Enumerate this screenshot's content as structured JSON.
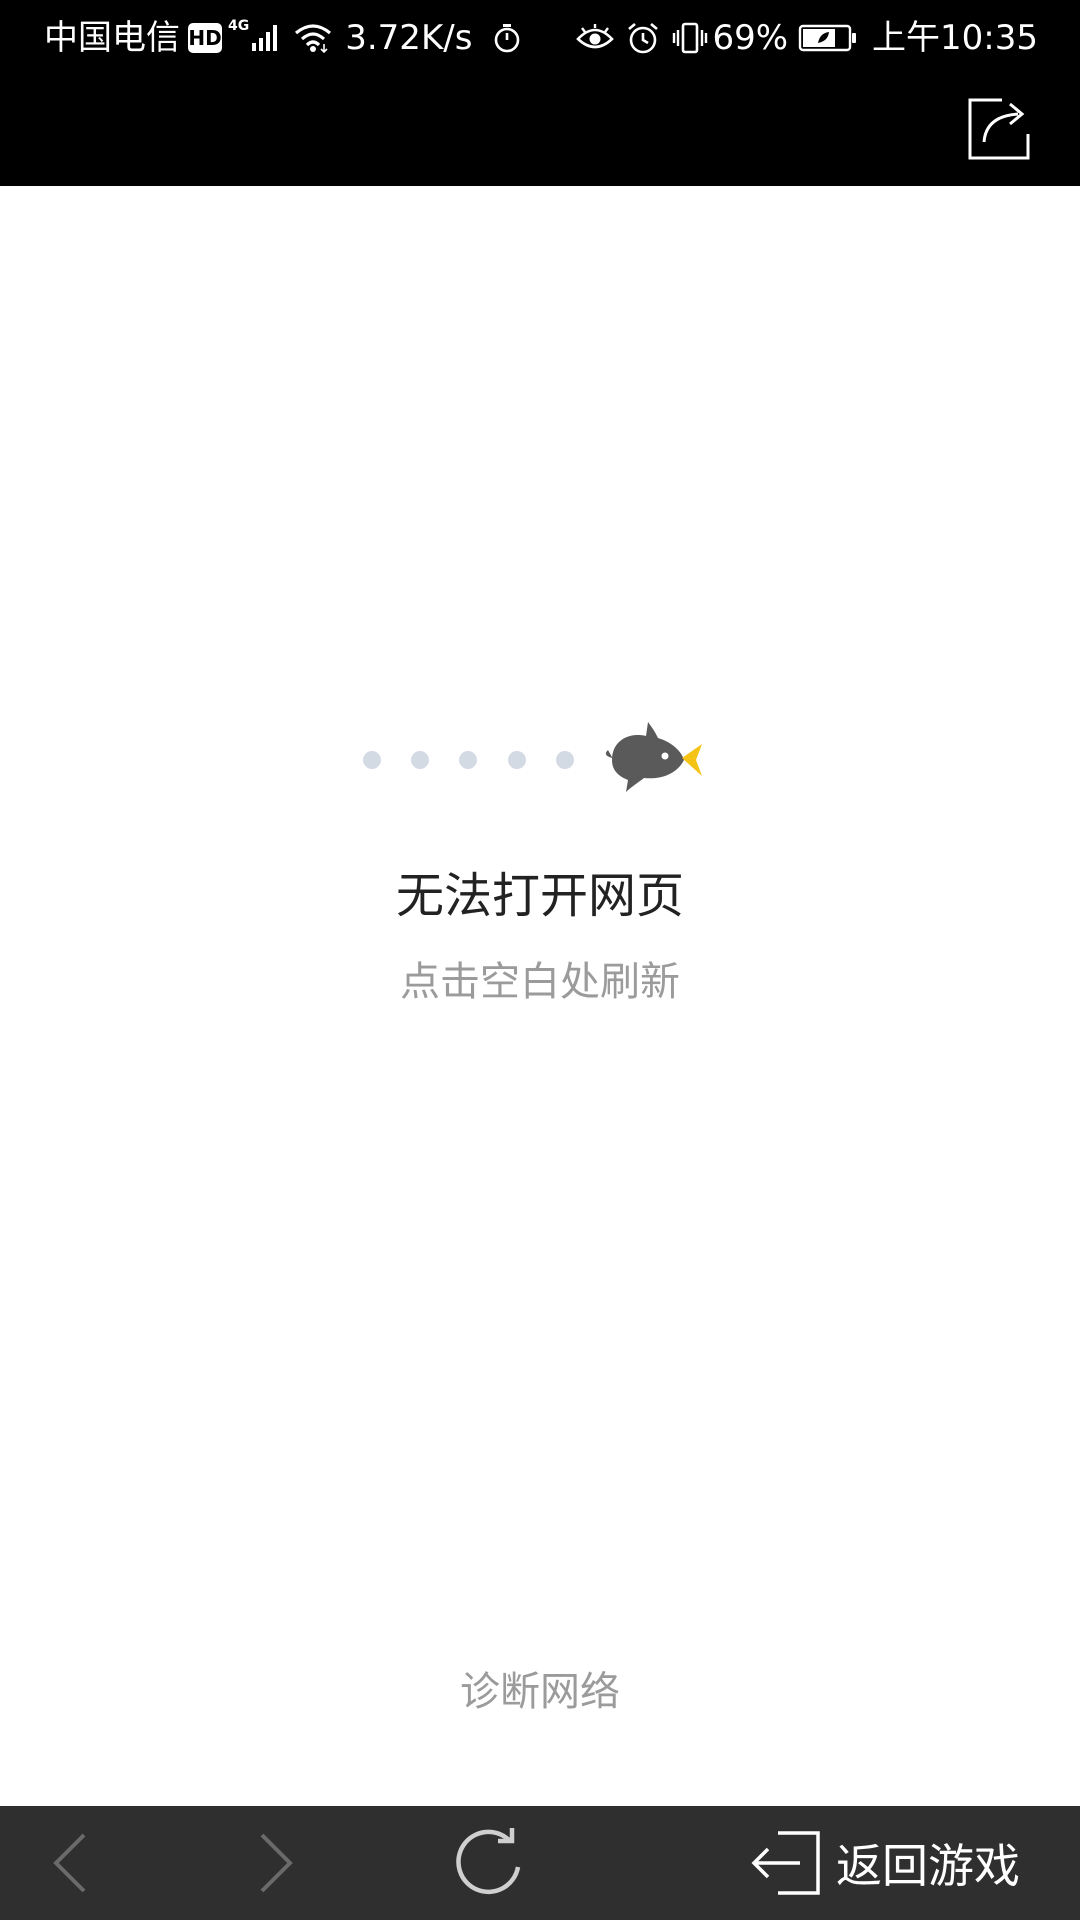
{
  "status_bar": {
    "carrier": "中国电信",
    "hd_badge": "HD",
    "network_type": "4G",
    "net_speed": "3.72K/s",
    "battery_percent": "69%",
    "time": "上午10:35",
    "icons": [
      "hd-icon",
      "signal-icon",
      "wifi-icon",
      "stopwatch-icon",
      "eye-icon",
      "alarm-icon",
      "vibrate-icon",
      "battery-icon"
    ]
  },
  "header": {
    "share_icon": "share-icon"
  },
  "error_page": {
    "title": "无法打开网页",
    "hint": "点击空白处刷新",
    "diagnose_link": "诊断网络",
    "loader_dots": 5,
    "mascot_icon": "bird-icon"
  },
  "toolbar": {
    "back_icon": "chevron-left-icon",
    "forward_icon": "chevron-right-icon",
    "reload_icon": "reload-icon",
    "return_icon": "exit-icon",
    "return_label": "返回游戏"
  },
  "colors": {
    "status_bar_bg": "#000000",
    "toolbar_bg": "#2f2f2f",
    "title_text": "#222222",
    "hint_text": "#9b9b9b",
    "loader_dot": "#d4dae3",
    "mascot_body": "#5a5a5a",
    "mascot_beak": "#f5c316",
    "toolbar_icon_disabled": "#6a6a6a",
    "toolbar_icon_active": "#ffffff"
  }
}
